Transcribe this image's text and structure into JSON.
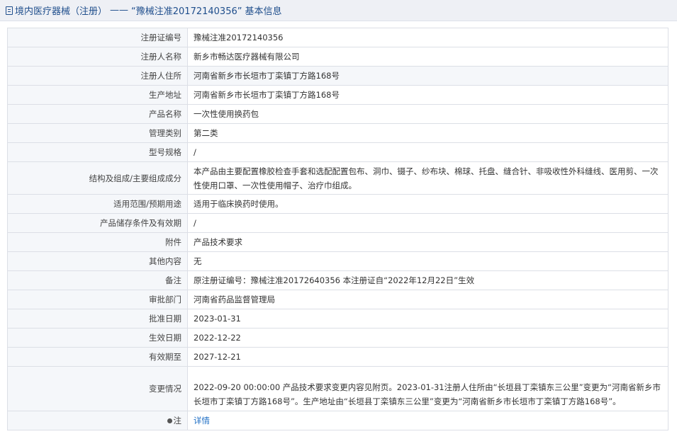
{
  "title": {
    "prefix": "境内医疗器械（注册）",
    "separator": "——",
    "reg": "“豫械注准20172140356”",
    "suffix": "基本信息"
  },
  "rows": [
    {
      "label": "注册证编号",
      "value": "豫械注准20172140356"
    },
    {
      "label": "注册人名称",
      "value": "新乡市畅达医疗器械有限公司"
    },
    {
      "label": "注册人住所",
      "value": "河南省新乡市长垣市丁栾镇丁方路168号"
    },
    {
      "label": "生产地址",
      "value": "河南省新乡市长垣市丁栾镇丁方路168号"
    },
    {
      "label": "产品名称",
      "value": "一次性使用换药包"
    },
    {
      "label": "管理类别",
      "value": "第二类"
    },
    {
      "label": "型号规格",
      "value": "/"
    },
    {
      "label": "结构及组成/主要组成成分",
      "value": "本产品由主要配置橡胶检查手套和选配配置包布、洞巾、镊子、纱布块、棉球、托盘、缝合针、非吸收性外科缝线、医用剪、一次性使用口罩、一次性使用帽子、治疗巾组成。"
    },
    {
      "label": "适用范围/预期用途",
      "value": "适用于临床换药时使用。"
    },
    {
      "label": "产品储存条件及有效期",
      "value": "/"
    },
    {
      "label": "附件",
      "value": "产品技术要求"
    },
    {
      "label": "其他内容",
      "value": "无"
    },
    {
      "label": "备注",
      "value": "原注册证编号：豫械注准20172640356 本注册证自“2022年12月22日”生效"
    },
    {
      "label": "审批部门",
      "value": "河南省药品监督管理局"
    },
    {
      "label": "批准日期",
      "value": "2023-01-31"
    },
    {
      "label": "生效日期",
      "value": "2022-12-22"
    },
    {
      "label": "有效期至",
      "value": "2027-12-21"
    },
    {
      "label": "变更情况",
      "value": "2022-09-20 00:00:00 产品技术要求变更内容见附页。2023-01-31注册人住所由“长垣县丁栾镇东三公里”变更为“河南省新乡市长垣市丁栾镇丁方路168号”。生产地址由“长垣县丁栾镇东三公里”变更为“河南省新乡市长垣市丁栾镇丁方路168号”。"
    }
  ],
  "note": {
    "label": "注",
    "link": "详情"
  }
}
